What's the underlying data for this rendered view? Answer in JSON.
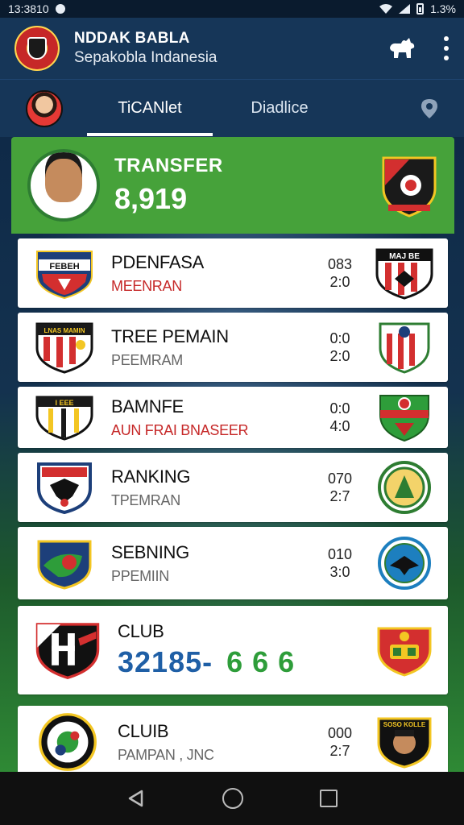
{
  "status_bar": {
    "time": "13:3810",
    "battery": "1.3%"
  },
  "app": {
    "title": "NDDAK BABLA",
    "subtitle": "Sepakobla Indanesia"
  },
  "tabs": [
    {
      "label": "TiCANlet"
    },
    {
      "label": "Diadlice"
    }
  ],
  "featured": {
    "label": "TRANSFER",
    "value": "8,919"
  },
  "cards": [
    {
      "title": "PDENFASA",
      "subtitle": "MEENRAN",
      "subtitle_color": "red",
      "score_top": "083",
      "score_bottom": "2:0",
      "left_crest_text": "FEBEH",
      "right_crest_text": "MAJ BE"
    },
    {
      "title": "TREE PEMAIN",
      "subtitle": "PEEMRAM",
      "subtitle_color": "grey",
      "score_top": "0:0",
      "score_bottom": "2:0",
      "left_crest_text": "LNAS MAMIN",
      "right_crest_text": ""
    },
    {
      "title": "BAMNFE",
      "subtitle": "AUN FRAI BNASEER",
      "subtitle_color": "red",
      "score_top": "0:0",
      "score_bottom": "4:0",
      "left_crest_text": "I EEE",
      "right_crest_text": ""
    },
    {
      "title": "RANKING",
      "subtitle": "TPEMRAN",
      "subtitle_color": "grey",
      "score_top": "070",
      "score_bottom": "2:7",
      "left_crest_text": "",
      "right_crest_text": ""
    },
    {
      "title": "SEBNING",
      "subtitle": "PPEMIIN",
      "subtitle_color": "grey",
      "score_top": "010",
      "score_bottom": "3:0",
      "left_crest_text": "",
      "right_crest_text": ""
    }
  ],
  "club_card": {
    "title": "CLUB",
    "score_blue": "32185-",
    "score_green": "6  6  6"
  },
  "last_card": {
    "title": "CLUIB",
    "subtitle": "PAMPAN , JNC",
    "score_top": "000",
    "score_bottom": "2:7",
    "right_crest_text": "SOSO KOLLE"
  },
  "colors": {
    "app_bar": "#163658",
    "featured_green": "#46a23a",
    "accent_red": "#c62828",
    "score_blue": "#1f5fa6",
    "score_green": "#2e9d3a"
  }
}
